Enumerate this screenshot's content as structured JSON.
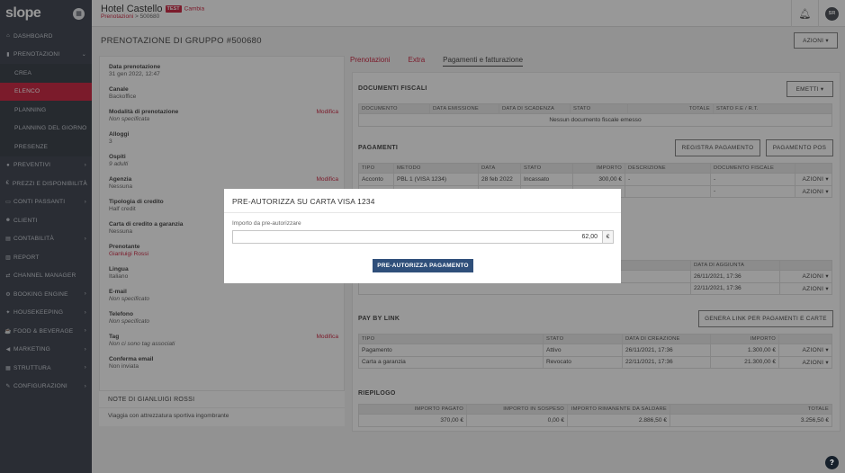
{
  "app": {
    "logo": "slope",
    "logo_button_icon": "calendar-icon"
  },
  "header": {
    "hotel_name": "Hotel Castello",
    "test_badge": "TEST",
    "change_link": "Cambia",
    "breadcrumb": {
      "parent": "Prenotazioni",
      "separator": " > ",
      "current": "500680"
    },
    "user_initials": "SR"
  },
  "sidebar": {
    "items": [
      {
        "label": "DASHBOARD",
        "icon": "home-icon"
      },
      {
        "label": "PRENOTAZIONI",
        "icon": "bookmark-icon"
      },
      {
        "label": "CREA"
      },
      {
        "label": "ELENCO"
      },
      {
        "label": "PLANNING"
      },
      {
        "label": "PLANNING DEL GIORNO"
      },
      {
        "label": "PRESENZE"
      },
      {
        "label": "PREVENTIVI",
        "icon": "circle-icon"
      },
      {
        "label": "PREZZI E DISPONIBILITÀ",
        "icon": "euro-icon"
      },
      {
        "label": "CONTI PASSANTI",
        "icon": "card-icon"
      },
      {
        "label": "CLIENTI",
        "icon": "users-icon"
      },
      {
        "label": "CONTABILITÀ",
        "icon": "ledger-icon"
      },
      {
        "label": "REPORT",
        "icon": "chart-icon"
      },
      {
        "label": "CHANNEL MANAGER",
        "icon": "share-icon"
      },
      {
        "label": "BOOKING ENGINE",
        "icon": "gear-icon"
      },
      {
        "label": "HOUSEKEEPING",
        "icon": "broom-icon"
      },
      {
        "label": "FOOD & BEVERAGE",
        "icon": "cup-icon"
      },
      {
        "label": "MARKETING",
        "icon": "megaphone-icon"
      },
      {
        "label": "STRUTTURA",
        "icon": "building-icon"
      },
      {
        "label": "CONFIGURAZIONI",
        "icon": "wrench-icon"
      }
    ]
  },
  "page": {
    "title": "PRENOTAZIONE DI GRUPPO #500680",
    "actions_button": "AZIONI"
  },
  "details": {
    "data_prenotazione": {
      "label": "Data prenotazione",
      "value": "31 gen 2022, 12:47"
    },
    "canale": {
      "label": "Canale",
      "value": "Backoffice"
    },
    "modalita": {
      "label": "Modalità di prenotazione",
      "value": "Non specificata",
      "edit": "Modifica"
    },
    "alloggi": {
      "label": "Alloggi",
      "value": "3"
    },
    "ospiti": {
      "label": "Ospiti",
      "value": "9 adulti"
    },
    "agenzia": {
      "label": "Agenzia",
      "value": "Nessuna",
      "edit": "Modifica"
    },
    "tipologia_credito": {
      "label": "Tipologia di credito",
      "value": "Half credit"
    },
    "carta_garanzia": {
      "label": "Carta di credito a garanzia",
      "value": "Nessuna"
    },
    "prenotante": {
      "label": "Prenotante",
      "value": "Gianluigi Rossi"
    },
    "lingua": {
      "label": "Lingua",
      "value": "Italiano"
    },
    "email": {
      "label": "E-mail",
      "value": "Non specificato"
    },
    "telefono": {
      "label": "Telefono",
      "value": "Non specificato"
    },
    "tag": {
      "label": "Tag",
      "value": "Non ci sono tag associati",
      "edit": "Modifica"
    },
    "conferma_email": {
      "label": "Conferma email",
      "value": "Non inviata"
    }
  },
  "notes": {
    "title": "NOTE DI GIANLUIGI ROSSI",
    "text": "Viaggia con attrezzatura sportiva ingombrante"
  },
  "tabs": [
    {
      "label": "Prenotazioni"
    },
    {
      "label": "Extra"
    },
    {
      "label": "Pagamenti e fatturazione"
    }
  ],
  "documenti_fiscali": {
    "title": "DOCUMENTI FISCALI",
    "button": "EMETTI",
    "columns": [
      "DOCUMENTO",
      "DATA EMISSIONE",
      "DATA DI SCADENZA",
      "STATO",
      "TOTALE",
      "STATO F.E / R.T."
    ],
    "empty": "Nessun documento fiscale emesso"
  },
  "pagamenti": {
    "title": "PAGAMENTI",
    "buttons": {
      "registra": "REGISTRA PAGAMENTO",
      "pos": "PAGAMENTO POS"
    },
    "columns": [
      "TIPO",
      "METODO",
      "DATA",
      "STATO",
      "IMPORTO",
      "DESCRIZIONE",
      "DOCUMENTO FISCALE"
    ],
    "rows": [
      {
        "tipo": "Acconto",
        "metodo": "PBL 1 (VISA 1234)",
        "data": "28 feb 2022",
        "stato": "Incassato",
        "importo": "300,00 €",
        "descrizione": "-",
        "documento": "-",
        "azioni": "AZIONI"
      },
      {
        "tipo": "",
        "metodo": "",
        "data": "",
        "stato": "",
        "importo": "",
        "descrizione": "",
        "documento": "-",
        "azioni": "AZIONI"
      }
    ]
  },
  "carte_garanzia": {
    "column": "DATA DI AGGIUNTA",
    "rows": [
      {
        "data": "26/11/2021, 17:36",
        "azioni": "AZIONI"
      },
      {
        "data": "22/11/2021, 17:36",
        "azioni": "AZIONI"
      }
    ]
  },
  "pay_by_link": {
    "title": "PAY BY LINK",
    "button": "GENERA LINK PER PAGAMENTI E CARTE",
    "columns": [
      "TIPO",
      "STATO",
      "DATA DI CREAZIONE",
      "IMPORTO"
    ],
    "rows": [
      {
        "tipo": "Pagamento",
        "stato": "Attivo",
        "data": "26/11/2021, 17:36",
        "importo": "1.300,00 €",
        "azioni": "AZIONI"
      },
      {
        "tipo": "Carta a garanzia",
        "stato": "Revocato",
        "data": "22/11/2021, 17:36",
        "importo": "21.300,00 €",
        "azioni": "AZIONI"
      }
    ]
  },
  "riepilogo": {
    "title": "RIEPILOGO",
    "columns": [
      "IMPORTO PAGATO",
      "IMPORTO IN SOSPESO",
      "IMPORTO RIMANENTE DA SALDARE",
      "TOTALE"
    ],
    "values": [
      "370,00 €",
      "0,00 €",
      "2.886,50 €",
      "3.256,50 €"
    ]
  },
  "modal": {
    "title": "PRE-AUTORIZZA SU CARTA VISA 1234",
    "field_label": "Importo da pre-autorizzare",
    "value": "62,00",
    "currency": "€",
    "button": "PRE-AUTORIZZA PAGAMENTO"
  },
  "help_label": "?"
}
